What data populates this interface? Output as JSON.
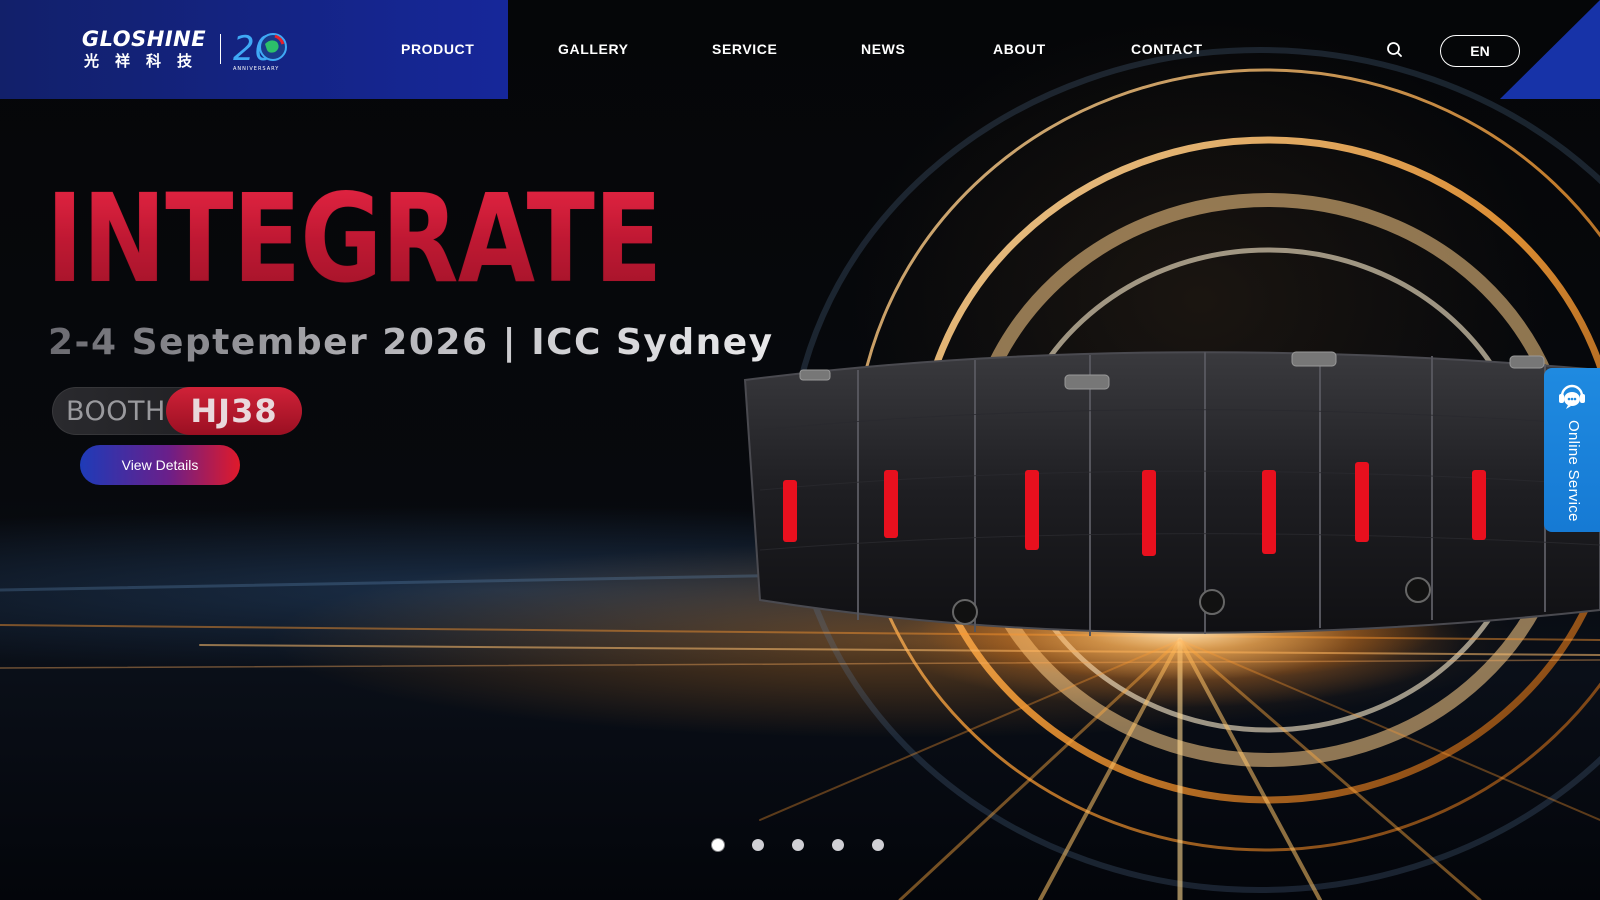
{
  "header": {
    "brand_name": "GLOSHINE",
    "brand_cn": "光祥科技",
    "anniversary_number": "20",
    "anniversary_text": "ANNIVERSARY",
    "nav": [
      {
        "label": "PRODUCT"
      },
      {
        "label": "GALLERY"
      },
      {
        "label": "SERVICE"
      },
      {
        "label": "NEWS"
      },
      {
        "label": "ABOUT"
      },
      {
        "label": "CONTACT"
      }
    ],
    "search_icon": "search-icon",
    "language": "EN"
  },
  "hero": {
    "title": "INTEGRATE",
    "subtitle": "2-4 September 2026 | ICC Sydney",
    "booth_label": "BOOTH",
    "booth_number": "HJ38",
    "cta_label": "View Details"
  },
  "carousel": {
    "slide_count": 5,
    "active_index": 0
  },
  "online_service": {
    "label": "Online Service",
    "icon": "chat-icon"
  },
  "colors": {
    "header_blue": "#16279a",
    "accent_red": "#c8102e",
    "service_blue": "#1f8ae0"
  }
}
